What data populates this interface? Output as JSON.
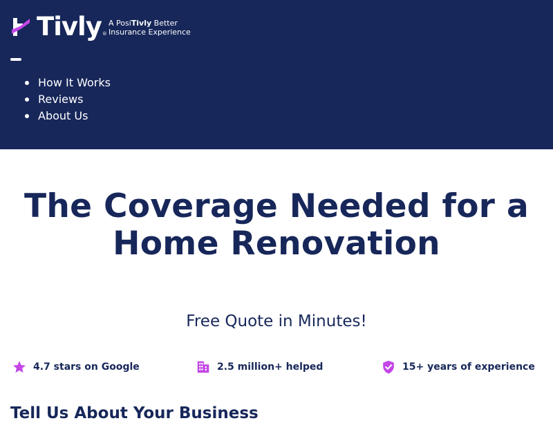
{
  "brand": {
    "name": "Tivly",
    "registered_mark": "®",
    "tagline_prefix": "A Posi",
    "tagline_brand": "Tivly",
    "tagline_suffix": " Better",
    "tagline_line2": "Insurance Experience",
    "accent_color": "#c446e6",
    "navy_color": "#17275a"
  },
  "nav": {
    "items": [
      {
        "label": "How It Works"
      },
      {
        "label": "Reviews"
      },
      {
        "label": "About Us"
      }
    ]
  },
  "hero": {
    "title_line1": "The Coverage Needed for a",
    "title_line2": "Home Renovation",
    "subtitle": "Free Quote in Minutes!"
  },
  "trust": [
    {
      "icon": "star-icon",
      "label": "4.7 stars on Google"
    },
    {
      "icon": "building-icon",
      "label": "2.5 million+ helped"
    },
    {
      "icon": "shield-check-icon",
      "label": "15+ years of experience"
    }
  ],
  "form": {
    "title": "Tell Us About Your Business"
  }
}
